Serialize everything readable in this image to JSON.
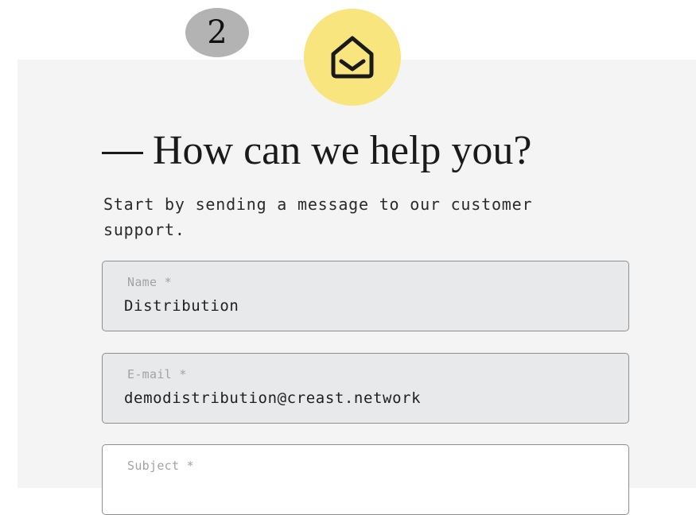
{
  "step_badge": "2",
  "icons": {
    "header": "mail-open-icon"
  },
  "colors": {
    "icon_circle": "#f8e57e",
    "panel_background": "#f4f4f5",
    "step_badge": "#b3b3b3"
  },
  "header": {
    "title": "How can we help you?",
    "subtitle": "Start by sending a message to our customer support."
  },
  "form": {
    "name": {
      "label": "Name *",
      "value": "Distribution"
    },
    "email": {
      "label": "E-mail *",
      "value": "demodistribution@creast.network"
    },
    "subject": {
      "label": "Subject *",
      "value": ""
    }
  }
}
